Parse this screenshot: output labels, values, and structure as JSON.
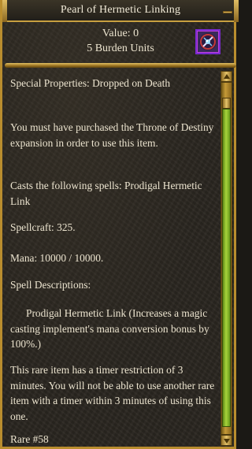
{
  "window": {
    "title": "Pearl of Hermetic Linking"
  },
  "header": {
    "value_line": "Value: 0",
    "burden_line": "5 Burden Units",
    "icon": "pearl-item-icon"
  },
  "description": {
    "paragraphs": [
      "Special Properties: Dropped on Death",
      "You must have purchased the Throne of Destiny expansion in order to use this item.",
      "Casts the following spells: Prodigal Hermetic Link",
      "Spellcraft: 325.",
      "Mana: 10000 / 10000.",
      "Spell Descriptions:",
      "Prodigal Hermetic Link (Increases a magic casting implement's mana conversion bonus by 100%.)",
      "This rare item has a timer restriction of 3 minutes. You will not be able to use another rare item with a timer within 3 minutes of using this one.",
      "Rare #58"
    ]
  },
  "colors": {
    "gold_border": "#b98d2e",
    "text": "#ece4cf",
    "scroll_thumb": "#a6d33b"
  }
}
